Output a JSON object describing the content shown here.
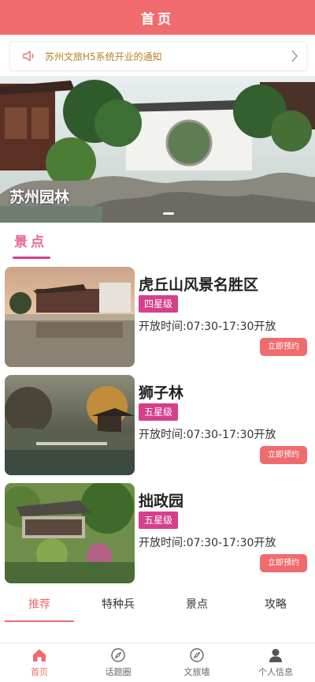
{
  "header": {
    "title": "首页"
  },
  "notice": {
    "text": "苏州文旅H5系统开业的通知"
  },
  "banner": {
    "title": "苏州园林"
  },
  "section": {
    "title": "景点"
  },
  "attractions": [
    {
      "name": "虎丘山风景名胜区",
      "rating": "四星级",
      "hours": "开放时间:07:30-17:30开放",
      "book_label": "立即预约"
    },
    {
      "name": "狮子林",
      "rating": "五星级",
      "hours": "开放时间:07:30-17:30开放",
      "book_label": "立即预约"
    },
    {
      "name": "拙政园",
      "rating": "五星级",
      "hours": "开放时间:07:30-17:30开放",
      "book_label": "立即预约"
    }
  ],
  "tabs": [
    {
      "label": "推荐",
      "active": true
    },
    {
      "label": "特种兵"
    },
    {
      "label": "景点"
    },
    {
      "label": "攻略"
    }
  ],
  "bottom_nav": [
    {
      "label": "首页",
      "icon": "home-icon",
      "active": true
    },
    {
      "label": "话题圈",
      "icon": "compass-icon"
    },
    {
      "label": "文旅墙",
      "icon": "compass-icon"
    },
    {
      "label": "个人信息",
      "icon": "user-icon"
    }
  ],
  "colors": {
    "primary": "#f06b6e",
    "badge": "#d63f8c",
    "notice_text": "#b5822a"
  }
}
